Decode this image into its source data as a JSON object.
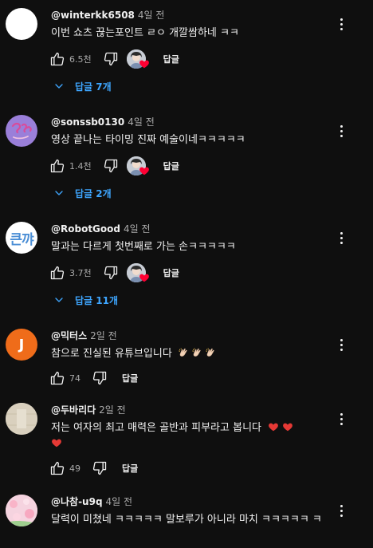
{
  "comments": [
    {
      "handle": "@winterkk6508",
      "time": "4일 전",
      "text": "이번 쇼츠 끊는포인트 ㄹㅇ 개깔쌈하네 ㅋㅋ",
      "likes": "6.5천",
      "reply_label": "답글",
      "replies_label": "답글 7개",
      "avatar": "white-circle"
    },
    {
      "handle": "@sonssb0130",
      "time": "4일 전",
      "text": "영상 끝나는 타이밍 진짜 예술이네ㅋㅋㅋㅋㅋ",
      "likes": "1.4천",
      "reply_label": "답글",
      "replies_label": "답글 2개",
      "avatar": "purple-doodle"
    },
    {
      "handle": "@RobotGood",
      "time": "4일 전",
      "text": "말과는 다르게 첫번째로 가는 손ㅋㅋㅋㅋㅋ",
      "likes": "3.7천",
      "reply_label": "답글",
      "replies_label": "답글 11개",
      "avatar_text": "큰꺄",
      "avatar": "text-logo"
    },
    {
      "handle": "@믹터스",
      "time": "2일 전",
      "text": "참으로 진실된 유튜브입니다",
      "likes": "74",
      "reply_label": "답글",
      "avatar_text": "J",
      "avatar": "orange-letter",
      "text_emojis": [
        "clapping-hands",
        "clapping-hands",
        "clapping-hands"
      ]
    },
    {
      "handle": "@두바리다",
      "time": "2일 전",
      "text": "저는 여자의 최고 매력은 골반과 피부라고 봅니다",
      "likes": "49",
      "reply_label": "답글",
      "avatar": "beige-photo",
      "text_emojis": [
        "red-heart",
        "red-heart",
        "red-heart"
      ]
    },
    {
      "handle": "@나참-u9q",
      "time": "4일 전",
      "text": "달력이 미쳤네 ㅋㅋㅋㅋㅋ 말보루가 아니라 마치 ㅋㅋㅋㅋㅋ ㅋ",
      "avatar": "pink-flowers"
    }
  ],
  "colors": {
    "background": "#0f0f0f",
    "text": "#f1f1f1",
    "secondary_text": "#aaaaaa",
    "reply_link": "#3ea6ff",
    "heart": "#ff0033"
  },
  "icons": {
    "like": "thumb-up-icon",
    "dislike": "thumb-down-icon",
    "more": "more-vert-icon",
    "expand": "chevron-down-icon",
    "creator_heart": "creator-heart-icon"
  }
}
